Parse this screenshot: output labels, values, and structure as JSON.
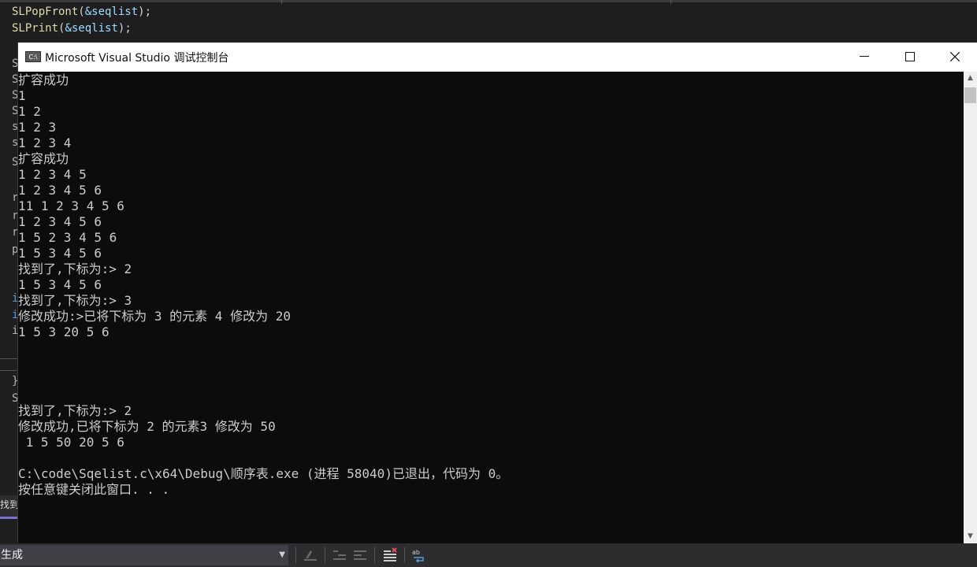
{
  "editor": {
    "code_lines": [
      {
        "fn": "SLPopFront",
        "open": "(",
        "arg": "&seqlist",
        "close": ");"
      },
      {
        "fn": "SLPrint",
        "open": "(",
        "arg": "&seqlist",
        "close": ");"
      }
    ],
    "gutter_fragments": [
      "S",
      "S",
      "S",
      "S",
      "s",
      "s",
      "S",
      "r",
      "r",
      "r",
      "p",
      "i",
      "i",
      "i",
      "}",
      "S"
    ],
    "find_tab_label": "找到"
  },
  "console": {
    "title": "Microsoft Visual Studio 调试控制台",
    "app_icon_text": "C:\\",
    "minimize_icon": "minimize-icon",
    "maximize_icon": "maximize-icon",
    "close_icon": "close-icon",
    "lines": [
      "扩容成功",
      "1",
      "1 2",
      "1 2 3",
      "1 2 3 4",
      "扩容成功",
      "1 2 3 4 5",
      "1 2 3 4 5 6",
      "11 1 2 3 4 5 6",
      "1 2 3 4 5 6",
      "1 5 2 3 4 5 6",
      "1 5 3 4 5 6",
      "找到了,下标为:> 2",
      "1 5 3 4 5 6",
      "找到了,下标为:> 3",
      "修改成功:>已将下标为 3 的元素 4 修改为 20",
      "1 5 3 20 5 6",
      "",
      "",
      "",
      "",
      "找到了,下标为:> 2",
      "修改成功,已将下标为 2 的元素3 修改为 50",
      " 1 5 50 20 5 6",
      "",
      "C:\\code\\Sqelist.c\\x64\\Debug\\顺序表.exe (进程 58040)已退出，代码为 0。",
      "按任意键关闭此窗口. . ."
    ]
  },
  "toolbar": {
    "config_dropdown_label": "生成",
    "icons": [
      "bookmark-icon",
      "outdent-icon",
      "indent-icon",
      "clear-all-icon",
      "word-wrap-icon"
    ]
  }
}
